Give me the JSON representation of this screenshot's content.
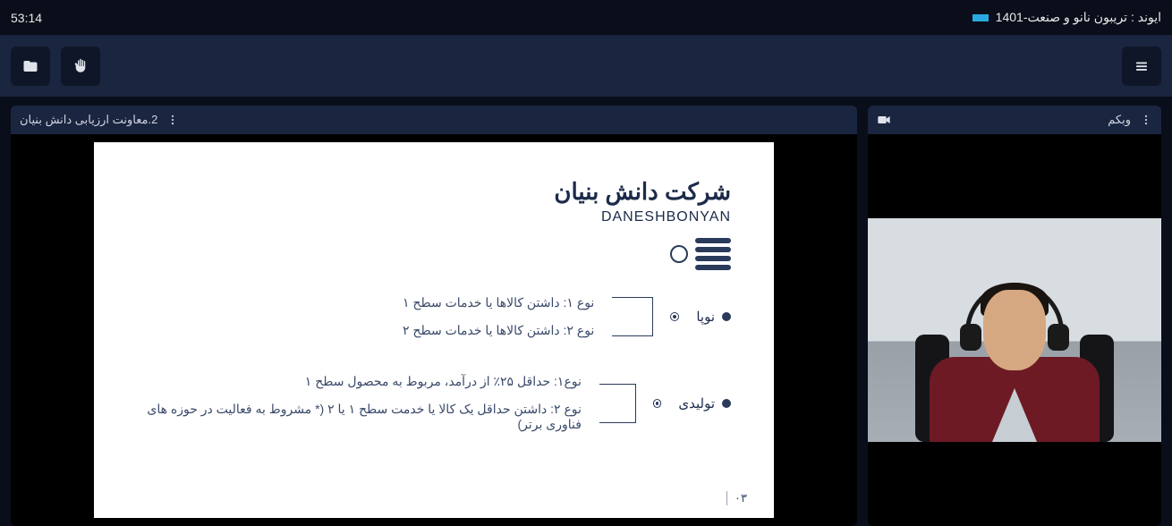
{
  "header": {
    "timer": "53:14",
    "event_title": "ایوند : تریبون نانو و صنعت-1401"
  },
  "presentation": {
    "panel_title": "2.معاونت ارزیابی دانش بنیان",
    "slide": {
      "title": "شرکت دانش بنیان",
      "subtitle": "DANESHBONYAN",
      "groups": [
        {
          "label": "نوپا",
          "lines": [
            "نوع ۱: داشتن کالاها یا خدمات سطح ۱",
            "نوع ۲: داشتن کالاها یا خدمات سطح ۲"
          ]
        },
        {
          "label": "تولیدی",
          "lines": [
            "نوع۱: حداقل ۲۵٪ از درآمد، مربوط به محصول سطح ۱",
            "نوع ۲: داشتن حداقل یک کالا یا خدمت سطح ۱ یا ۲ (* مشروط به فعالیت در حوزه های فناوری برتر)"
          ]
        }
      ],
      "page_number": "۰۳"
    }
  },
  "webcam": {
    "panel_title": "وبکم"
  },
  "icons": {
    "folder": "folder-icon",
    "hand": "hand-icon",
    "menu": "menu-icon",
    "more": "more-icon",
    "camera": "camera-icon"
  }
}
